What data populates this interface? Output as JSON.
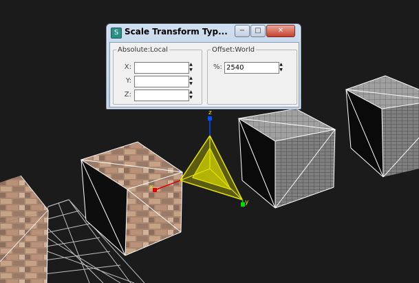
{
  "dialog": {
    "title": "Scale Transform Typ...",
    "app_icon": "3ds-max-icon",
    "controls": {
      "minimize": "−",
      "maximize": "□",
      "close": "✕"
    },
    "absolute_group": {
      "legend": "Absolute:Local",
      "fields": [
        {
          "label": "X:",
          "value": ""
        },
        {
          "label": "Y:",
          "value": ""
        },
        {
          "label": "Z:",
          "value": ""
        }
      ]
    },
    "offset_group": {
      "legend": "Offset:World",
      "field": {
        "label": "%:",
        "value": "2540"
      }
    }
  },
  "viewport": {
    "gizmo_axes": {
      "x": "x",
      "y": "y",
      "z": "z"
    },
    "colors": {
      "background": "#1b1b1b",
      "gizmo_yellow": "#e6e600",
      "axis_x": "#e00000",
      "axis_y": "#00e000",
      "axis_z": "#0050ff"
    }
  }
}
